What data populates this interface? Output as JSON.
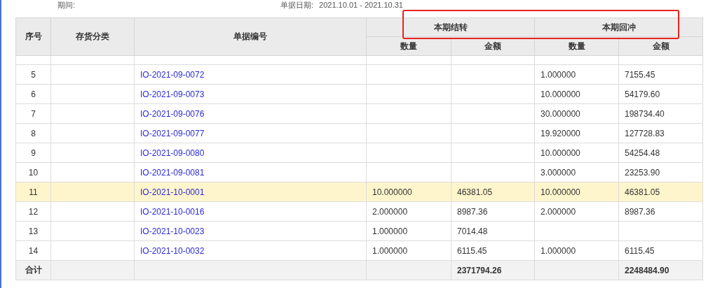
{
  "filter_bar": {
    "period_label": "期间:",
    "date_label": "单据日期:",
    "date_range": "2021.10.01 - 2021.10.31"
  },
  "table": {
    "columns": [
      "序号",
      "存货分类",
      "单据编号"
    ],
    "group_headers_framed": true,
    "groups": [
      {
        "title": "本期结转",
        "columns": [
          "数量",
          "金额"
        ]
      },
      {
        "title": "本期回冲",
        "columns": [
          "数量",
          "金额"
        ]
      }
    ],
    "rows": [
      {
        "index": "5",
        "category": "",
        "doc_no": "IO-2021-09-0072",
        "carry_qty": "",
        "carry_amount": "",
        "reversal_qty": "1.000000",
        "reversal_amount": "7155.45",
        "selected": false
      },
      {
        "index": "6",
        "category": "",
        "doc_no": "IO-2021-09-0073",
        "carry_qty": "",
        "carry_amount": "",
        "reversal_qty": "10.000000",
        "reversal_amount": "54179.60",
        "selected": false
      },
      {
        "index": "7",
        "category": "",
        "doc_no": "IO-2021-09-0076",
        "carry_qty": "",
        "carry_amount": "",
        "reversal_qty": "30.000000",
        "reversal_amount": "198734.40",
        "selected": false
      },
      {
        "index": "8",
        "category": "",
        "doc_no": "IO-2021-09-0077",
        "carry_qty": "",
        "carry_amount": "",
        "reversal_qty": "19.920000",
        "reversal_amount": "127728.83",
        "selected": false
      },
      {
        "index": "9",
        "category": "",
        "doc_no": "IO-2021-09-0080",
        "carry_qty": "",
        "carry_amount": "",
        "reversal_qty": "10.000000",
        "reversal_amount": "54254.48",
        "selected": false
      },
      {
        "index": "10",
        "category": "",
        "doc_no": "IO-2021-09-0081",
        "carry_qty": "",
        "carry_amount": "",
        "reversal_qty": "3.000000",
        "reversal_amount": "23253.90",
        "selected": false
      },
      {
        "index": "11",
        "category": "",
        "doc_no": "IO-2021-10-0001",
        "carry_qty": "10.000000",
        "carry_amount": "46381.05",
        "reversal_qty": "10.000000",
        "reversal_amount": "46381.05",
        "selected": true
      },
      {
        "index": "12",
        "category": "",
        "doc_no": "IO-2021-10-0016",
        "carry_qty": "2.000000",
        "carry_amount": "8987.36",
        "reversal_qty": "2.000000",
        "reversal_amount": "8987.36",
        "selected": false
      },
      {
        "index": "13",
        "category": "",
        "doc_no": "IO-2021-10-0023",
        "carry_qty": "1.000000",
        "carry_amount": "7014.48",
        "reversal_qty": "",
        "reversal_amount": "",
        "selected": false
      },
      {
        "index": "14",
        "category": "",
        "doc_no": "IO-2021-10-0032",
        "carry_qty": "1.000000",
        "carry_amount": "6115.45",
        "reversal_qty": "1.000000",
        "reversal_amount": "6115.45",
        "selected": false
      }
    ],
    "total": {
      "label": "合计",
      "carry_amount": "2371794.26",
      "reversal_amount": "2248484.90"
    }
  }
}
